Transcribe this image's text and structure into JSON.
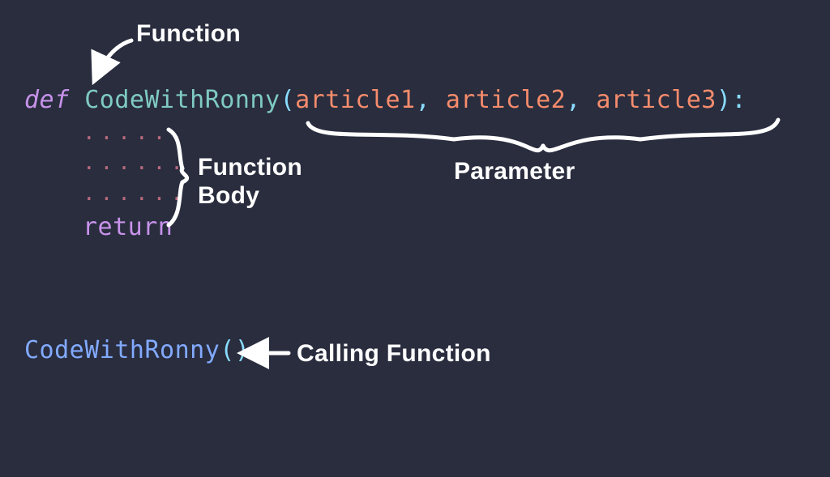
{
  "labels": {
    "function": "Function",
    "function_body_l1": "Function",
    "function_body_l2": "Body",
    "parameter": "Parameter",
    "calling_function": "Calling Function"
  },
  "code": {
    "def_keyword": "def",
    "function_name": "CodeWithRonny",
    "open_paren": "(",
    "param1": "article1",
    "comma1": ",",
    "param2": "article2",
    "comma2": ",",
    "param3": "article3",
    "close_paren": ")",
    "colon": ":",
    "body_dots": "......",
    "return_keyword": "return"
  },
  "call": {
    "function_name": "CodeWithRonny",
    "open_paren": "(",
    "close_paren": ")"
  },
  "colors": {
    "background": "#292d3e",
    "keyword": "#c792ea",
    "function_def": "#7fcac3",
    "function_call": "#82aaff",
    "parameter": "#f78c6c",
    "punctuation": "#89ddff",
    "annotation": "#ffffff",
    "dots": "#b76a7c"
  }
}
